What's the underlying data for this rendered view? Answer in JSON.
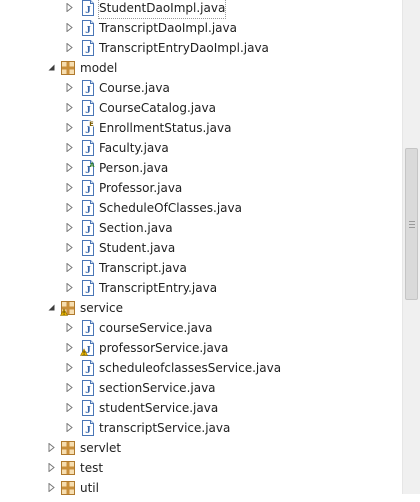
{
  "tree": [
    {
      "label": "StudentDaoImpl.java",
      "type": "java",
      "depth": 2,
      "expander": "collapsed",
      "selected": true
    },
    {
      "label": "TranscriptDaoImpl.java",
      "type": "java",
      "depth": 2,
      "expander": "collapsed"
    },
    {
      "label": "TranscriptEntryDaoImpl.java",
      "type": "java",
      "depth": 2,
      "expander": "collapsed"
    },
    {
      "label": "model",
      "type": "package",
      "depth": 1,
      "expander": "expanded"
    },
    {
      "label": "Course.java",
      "type": "java",
      "depth": 2,
      "expander": "collapsed"
    },
    {
      "label": "CourseCatalog.java",
      "type": "java",
      "depth": 2,
      "expander": "collapsed"
    },
    {
      "label": "EnrollmentStatus.java",
      "type": "java-enum",
      "depth": 2,
      "expander": "collapsed"
    },
    {
      "label": "Faculty.java",
      "type": "java",
      "depth": 2,
      "expander": "collapsed"
    },
    {
      "label": "Person.java",
      "type": "java-abstract",
      "depth": 2,
      "expander": "collapsed"
    },
    {
      "label": "Professor.java",
      "type": "java",
      "depth": 2,
      "expander": "collapsed"
    },
    {
      "label": "ScheduleOfClasses.java",
      "type": "java",
      "depth": 2,
      "expander": "collapsed"
    },
    {
      "label": "Section.java",
      "type": "java",
      "depth": 2,
      "expander": "collapsed"
    },
    {
      "label": "Student.java",
      "type": "java",
      "depth": 2,
      "expander": "collapsed"
    },
    {
      "label": "Transcript.java",
      "type": "java",
      "depth": 2,
      "expander": "collapsed"
    },
    {
      "label": "TranscriptEntry.java",
      "type": "java",
      "depth": 2,
      "expander": "collapsed"
    },
    {
      "label": "service",
      "type": "package-warning",
      "depth": 1,
      "expander": "expanded"
    },
    {
      "label": "courseService.java",
      "type": "java",
      "depth": 2,
      "expander": "collapsed"
    },
    {
      "label": "professorService.java",
      "type": "java-warning",
      "depth": 2,
      "expander": "collapsed"
    },
    {
      "label": "scheduleofclassesService.java",
      "type": "java",
      "depth": 2,
      "expander": "collapsed"
    },
    {
      "label": "sectionService.java",
      "type": "java",
      "depth": 2,
      "expander": "collapsed"
    },
    {
      "label": "studentService.java",
      "type": "java",
      "depth": 2,
      "expander": "collapsed"
    },
    {
      "label": "transcriptService.java",
      "type": "java",
      "depth": 2,
      "expander": "collapsed"
    },
    {
      "label": "servlet",
      "type": "package",
      "depth": 1,
      "expander": "collapsed"
    },
    {
      "label": "test",
      "type": "package",
      "depth": 1,
      "expander": "collapsed"
    },
    {
      "label": "util",
      "type": "package",
      "depth": 1,
      "expander": "collapsed"
    }
  ],
  "icons": {
    "java": "java-file-icon",
    "java-enum": "java-enum-file-icon",
    "java-abstract": "java-abstract-file-icon",
    "java-warning": "java-file-warning-icon",
    "package": "package-icon",
    "package-warning": "package-warning-icon"
  },
  "colors": {
    "package": "#b07a2e",
    "java_border": "#4a76b6",
    "java_letter": "#3463a8",
    "warning": "#e8b400"
  }
}
